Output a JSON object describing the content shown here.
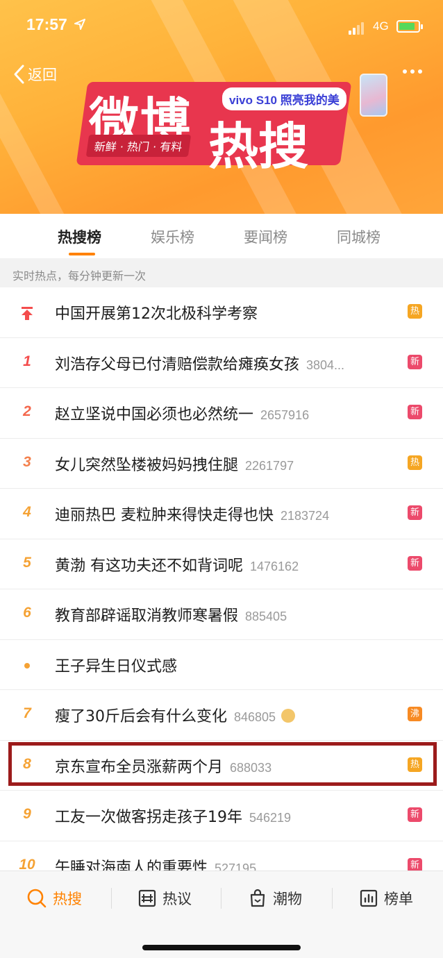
{
  "status": {
    "time": "17:57",
    "network": "4G"
  },
  "header": {
    "back_label": "返回",
    "logo_text_1": "微博",
    "logo_text_2": "热搜",
    "tagline": "新鲜 · 热门 · 有料",
    "ad_text": "vivo S10 照亮我的美"
  },
  "tabs": [
    {
      "label": "热搜榜",
      "active": true
    },
    {
      "label": "娱乐榜",
      "active": false
    },
    {
      "label": "要闻榜",
      "active": false
    },
    {
      "label": "同城榜",
      "active": false
    }
  ],
  "subheader": "实时热点，每分钟更新一次",
  "list": [
    {
      "rank": "",
      "marker": "pin",
      "title": "中国开展第12次北极科学考察",
      "count": "",
      "badge": "热",
      "badge_color": "#f5a623"
    },
    {
      "rank": "1",
      "marker": "number",
      "title": "刘浩存父母已付清赔偿款给瘫痪女孩",
      "count": "3804...",
      "badge": "新",
      "badge_color": "#ec4a6b"
    },
    {
      "rank": "2",
      "marker": "number",
      "title": "赵立坚说中国必须也必然统一",
      "count": "2657916",
      "badge": "新",
      "badge_color": "#ec4a6b"
    },
    {
      "rank": "3",
      "marker": "number",
      "title": "女儿突然坠楼被妈妈拽住腿",
      "count": "2261797",
      "badge": "热",
      "badge_color": "#f5a623"
    },
    {
      "rank": "4",
      "marker": "number",
      "title": "迪丽热巴 麦粒肿来得快走得也快",
      "count": "2183724",
      "badge": "新",
      "badge_color": "#ec4a6b"
    },
    {
      "rank": "5",
      "marker": "number",
      "title": "黄渤 有这功夫还不如背词呢",
      "count": "1476162",
      "badge": "新",
      "badge_color": "#ec4a6b"
    },
    {
      "rank": "6",
      "marker": "number",
      "title": "教育部辟谣取消教师寒暑假",
      "count": "885405",
      "badge": "",
      "badge_color": ""
    },
    {
      "rank": "",
      "marker": "dot",
      "title": "王子异生日仪式感",
      "count": "",
      "badge": "",
      "badge_color": ""
    },
    {
      "rank": "7",
      "marker": "number",
      "title": "瘦了30斤后会有什么变化",
      "count": "846805",
      "emoji": "doge-emoji",
      "badge": "沸",
      "badge_color": "#f78a23"
    },
    {
      "rank": "8",
      "marker": "number",
      "title": "京东宣布全员涨薪两个月",
      "count": "688033",
      "badge": "热",
      "badge_color": "#f5a623"
    },
    {
      "rank": "9",
      "marker": "number",
      "title": "工友一次做客拐走孩子19年",
      "count": "546219",
      "badge": "新",
      "badge_color": "#ec4a6b"
    },
    {
      "rank": "10",
      "marker": "number",
      "title": "午睡对海南人的重要性",
      "count": "527195",
      "badge": "新",
      "badge_color": "#ec4a6b"
    }
  ],
  "bottom_nav": [
    {
      "label": "热搜",
      "icon": "search-fire-icon",
      "active": true
    },
    {
      "label": "热议",
      "icon": "discussion-icon",
      "active": false
    },
    {
      "label": "潮物",
      "icon": "shopping-bag-icon",
      "active": false
    },
    {
      "label": "榜单",
      "icon": "chart-icon",
      "active": false
    }
  ],
  "colors": {
    "accent": "#ff8200",
    "highlight_border": "#9c1b1b"
  }
}
